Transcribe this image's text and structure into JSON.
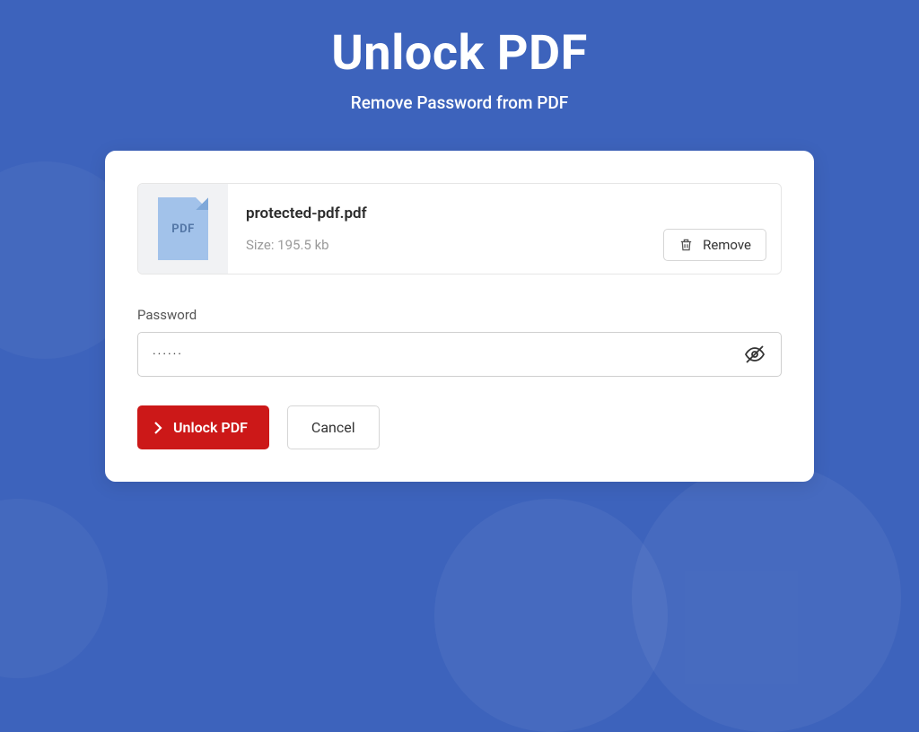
{
  "header": {
    "title": "Unlock PDF",
    "subtitle": "Remove Password from PDF"
  },
  "file": {
    "icon_label": "PDF",
    "name": "protected-pdf.pdf",
    "size_text": "Size: 195.5 kb",
    "remove_label": "Remove"
  },
  "password": {
    "label": "Password",
    "value": "······"
  },
  "actions": {
    "unlock_label": "Unlock PDF",
    "cancel_label": "Cancel"
  },
  "colors": {
    "background": "#3d63bc",
    "primary": "#cc1818"
  }
}
